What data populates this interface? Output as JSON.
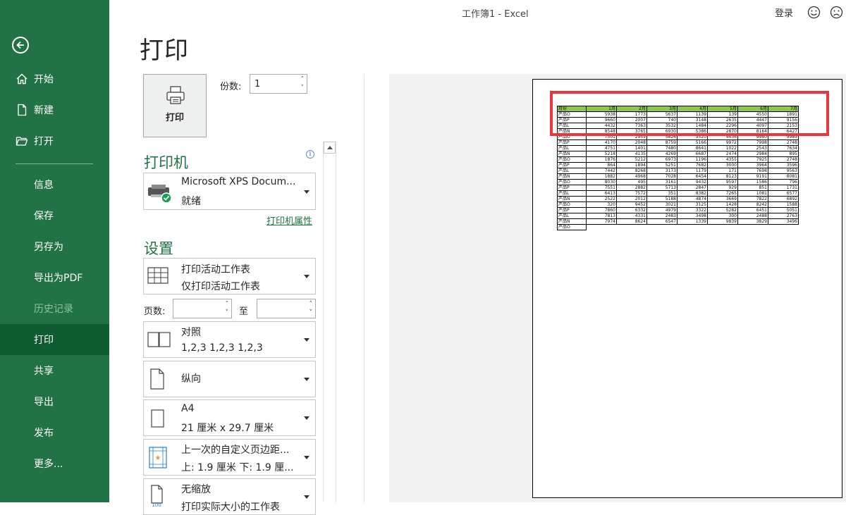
{
  "window": {
    "title": "工作簿1  -  Excel",
    "login_label": "登录"
  },
  "colors": {
    "sidebar_bg": "#217346",
    "sidebar_selected": "#0e5c2f",
    "accent_green": "#217346",
    "header_fill": "#8ec84a",
    "highlight_red": "#e8363a"
  },
  "sidebar": {
    "back_icon": "back-arrow-icon",
    "items": [
      {
        "label": "开始",
        "icon": "home-icon"
      },
      {
        "label": "新建",
        "icon": "new-document-icon"
      },
      {
        "label": "打开",
        "icon": "open-folder-icon"
      },
      {
        "label": "信息"
      },
      {
        "label": "保存"
      },
      {
        "label": "另存为"
      },
      {
        "label": "导出为PDF"
      },
      {
        "label": "历史记录",
        "state": "disabled"
      },
      {
        "label": "打印",
        "state": "selected"
      },
      {
        "label": "共享"
      },
      {
        "label": "导出"
      },
      {
        "label": "发布"
      },
      {
        "label": "更多..."
      }
    ]
  },
  "main": {
    "title": "打印",
    "print_button": {
      "label": "打印",
      "icon": "printer-icon"
    },
    "copies": {
      "label": "份数:",
      "value": "1"
    },
    "printer": {
      "section_title": "打印机",
      "info_icon": "info-icon",
      "name": "Microsoft XPS Docum...",
      "status": "就绪",
      "properties_link": "打印机属性"
    },
    "settings": {
      "section_title": "设置",
      "scope": {
        "line1": "打印活动工作表",
        "line2": "仅打印活动工作表"
      },
      "pages": {
        "label": "页数:",
        "to_label": "至",
        "from_value": "",
        "to_value": ""
      },
      "collation": {
        "line1": "对照",
        "line2": "1,2,3     1,2,3     1,2,3"
      },
      "orientation": {
        "line1": "纵向"
      },
      "paper_size": {
        "line1": "A4",
        "line2": "21 厘米 x 29.7 厘米"
      },
      "margins": {
        "line1": "上一次的自定义页边距...",
        "line2": "上: 1.9 厘米 下: 1.9 厘..."
      },
      "scaling": {
        "line1": "无缩放",
        "line2": "打印实际大小的工作表"
      }
    }
  },
  "preview": {
    "header": [
      "月份",
      "1月",
      "2月",
      "3月",
      "4月",
      "5月",
      "6月",
      "7月"
    ],
    "rows": [
      [
        "产品O",
        "5938",
        "1773",
        "5637",
        "1139",
        "139",
        "4550",
        "1891"
      ],
      [
        "产品P",
        "9660",
        "2007",
        "740",
        "3148",
        "2635",
        "4447",
        "9156"
      ],
      [
        "产品L",
        "4432",
        "7363",
        "3532",
        "1484",
        "2296",
        "4097",
        "2153"
      ],
      [
        "产品N",
        "8548",
        "3765",
        "6930",
        "5386",
        "2870",
        "8164",
        "6427"
      ],
      [
        "产品O",
        "7501",
        "2959",
        "5826",
        "5520",
        "4436",
        "9980",
        "9989"
      ],
      [
        "产品P",
        "4170",
        "2048",
        "8759",
        "5166",
        "9972",
        "7998",
        "2748"
      ],
      [
        "产品L",
        "4751",
        "1401",
        "7480",
        "8641",
        "1022",
        "2543",
        "7634"
      ],
      [
        "产品N",
        "5218",
        "4135",
        "4269",
        "6687",
        "2474",
        "2984",
        "895"
      ],
      [
        "产品O",
        "1876",
        "5212",
        "6973",
        "1196",
        "4355",
        "7925",
        "2748"
      ],
      [
        "产品P",
        "864",
        "1894",
        "5251",
        "7682",
        "3000",
        "3964",
        "3596"
      ],
      [
        "产品L",
        "7442",
        "8268",
        "3173",
        "1179",
        "171",
        "7698",
        "9563"
      ],
      [
        "产品N",
        "1882",
        "4968",
        "7028",
        "6454",
        "8123",
        "9191",
        "8081"
      ],
      [
        "产品O",
        "8030",
        "495",
        "3161",
        "9432",
        "9597",
        "1586",
        "796"
      ],
      [
        "产品P",
        "7551",
        "2882",
        "5713",
        "2847",
        "929",
        "851",
        "1731"
      ],
      [
        "产品L",
        "6413",
        "7572",
        "351",
        "8382",
        "7265",
        "1081",
        "6577"
      ],
      [
        "产品N",
        "2522",
        "2012",
        "5188",
        "4874",
        "3669",
        "7822",
        "6892"
      ],
      [
        "产品O",
        "320",
        "9452",
        "3021",
        "3125",
        "1428",
        "8242",
        "1588"
      ],
      [
        "产品P",
        "7860",
        "6332",
        "4979",
        "3322",
        "5282",
        "6451",
        "5051"
      ],
      [
        "产品L",
        "7813",
        "4331",
        "2483",
        "3498",
        "300",
        "2488",
        "2763"
      ],
      [
        "产品N",
        "7974",
        "8624",
        "6547",
        "1339",
        "9839",
        "3829",
        "3496"
      ],
      [
        "产品O",
        "",
        "",
        "",
        "",
        "",
        "",
        ""
      ]
    ]
  }
}
